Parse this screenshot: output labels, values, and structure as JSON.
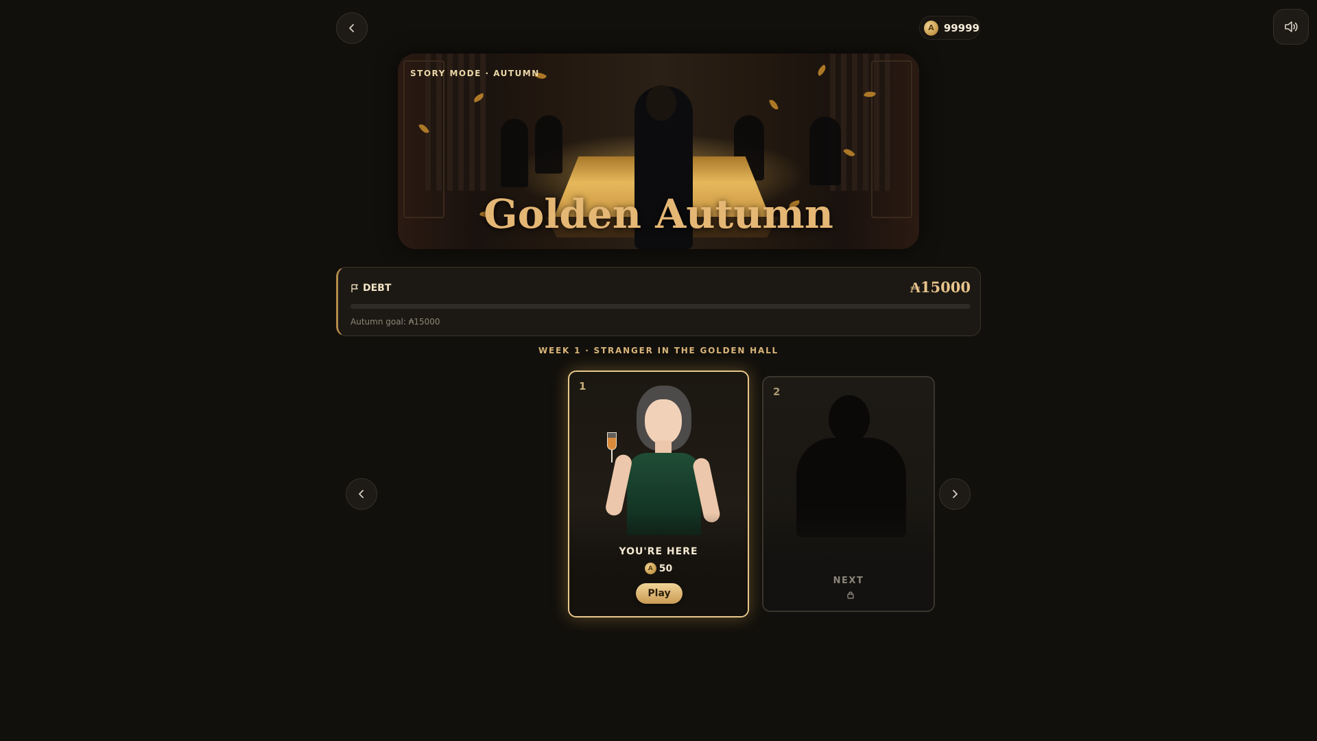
{
  "top_bar": {
    "coin_symbol": "A",
    "coin_balance": "99999"
  },
  "hero": {
    "label": "STORY MODE · AUTUMN",
    "title": "Golden Autumn"
  },
  "debt": {
    "label": "DEBT",
    "amount": "₳15000",
    "goal_text": "Autumn goal: ₳15000",
    "progress_fraction": 0
  },
  "week": {
    "title": "WEEK 1 · STRANGER IN THE GOLDEN HALL"
  },
  "cards": [
    {
      "number": "1",
      "status": "YOU'RE HERE",
      "reward_coin": "A",
      "reward": "50",
      "play_label": "Play"
    },
    {
      "number": "2",
      "status": "NEXT",
      "locked": true
    }
  ],
  "colors": {
    "accent_gold": "#e5b775",
    "background": "#12100c",
    "button_gold": "#d9ae67"
  },
  "icons": {
    "back": "chevron-left",
    "sound": "speaker-volume",
    "carousel_prev": "chevron-left",
    "carousel_next": "chevron-right",
    "debt": "flag",
    "lock": "lock"
  }
}
